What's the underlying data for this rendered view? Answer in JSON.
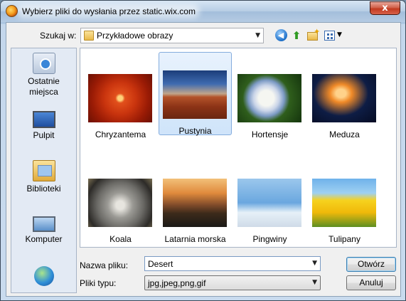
{
  "window": {
    "title": "Wybierz pliki do wysłania przez static.wix.com",
    "close_label": "x"
  },
  "toolbar": {
    "lookin_label": "Szukaj w:",
    "lookin_value": "Przykładowe obrazy"
  },
  "places": [
    {
      "label": "Ostatnie\nmiejsca",
      "icon": "recent-places-icon"
    },
    {
      "label": "Pulpit",
      "icon": "desktop-icon"
    },
    {
      "label": "Biblioteki",
      "icon": "libraries-icon"
    },
    {
      "label": "Komputer",
      "icon": "computer-icon"
    },
    {
      "label": "",
      "icon": "network-icon"
    }
  ],
  "files": [
    {
      "label": "Chryzantema",
      "selected": false
    },
    {
      "label": "Pustynia",
      "selected": true
    },
    {
      "label": "Hortensje",
      "selected": false
    },
    {
      "label": "Meduza",
      "selected": false
    },
    {
      "label": "Koala",
      "selected": false
    },
    {
      "label": "Latarnia morska",
      "selected": false
    },
    {
      "label": "Pingwiny",
      "selected": false
    },
    {
      "label": "Tulipany",
      "selected": false
    }
  ],
  "filename": {
    "label": "Nazwa pliku:",
    "value": "Desert"
  },
  "filetype": {
    "label": "Pliki typu:",
    "value": "jpg,jpeg,png,gif"
  },
  "buttons": {
    "open": "Otwórz",
    "cancel": "Anuluj"
  }
}
